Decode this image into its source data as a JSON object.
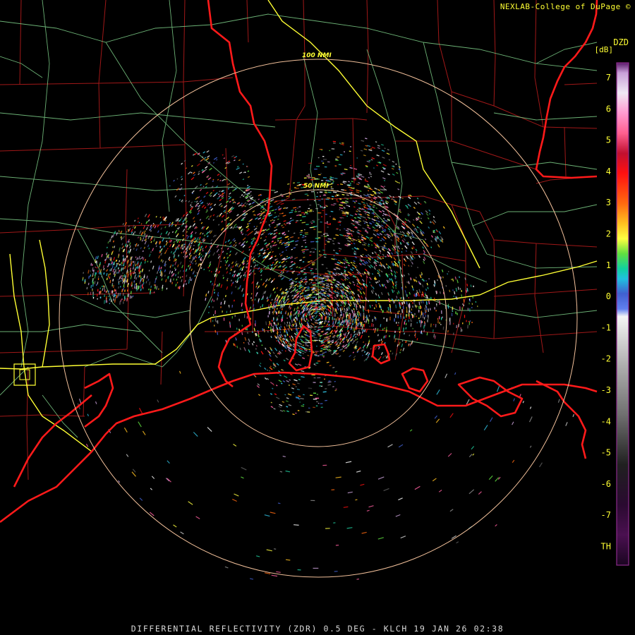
{
  "header": {
    "credit": "NEXLAB-College of DuPage ©"
  },
  "footer": {
    "title": "DIFFERENTIAL REFLECTIVITY (ZDR) 0.5 DEG - KLCH 19 JAN 26 02:38"
  },
  "legend": {
    "code": "DZD",
    "unit": "[dB]",
    "tick_labels": [
      "7",
      "6",
      "5",
      "4",
      "3",
      "2",
      "1",
      "0",
      "-1",
      "-2",
      "-3",
      "-4",
      "-5",
      "-6",
      "-7",
      "TH"
    ],
    "colors": {
      "border": "#8a2a8a",
      "text": "#ffff33"
    }
  },
  "map": {
    "range_rings": [
      {
        "label": "50 NMI",
        "range_nmi": 50
      },
      {
        "label": "100 NMI",
        "range_nmi": 100
      }
    ],
    "colors": {
      "background": "#000000",
      "coastline": "#ff1a1a",
      "county_lines": "#a01818",
      "highways": "#7fd18a",
      "interstates": "#ffff33",
      "range_rings": "#f2c09a"
    }
  }
}
